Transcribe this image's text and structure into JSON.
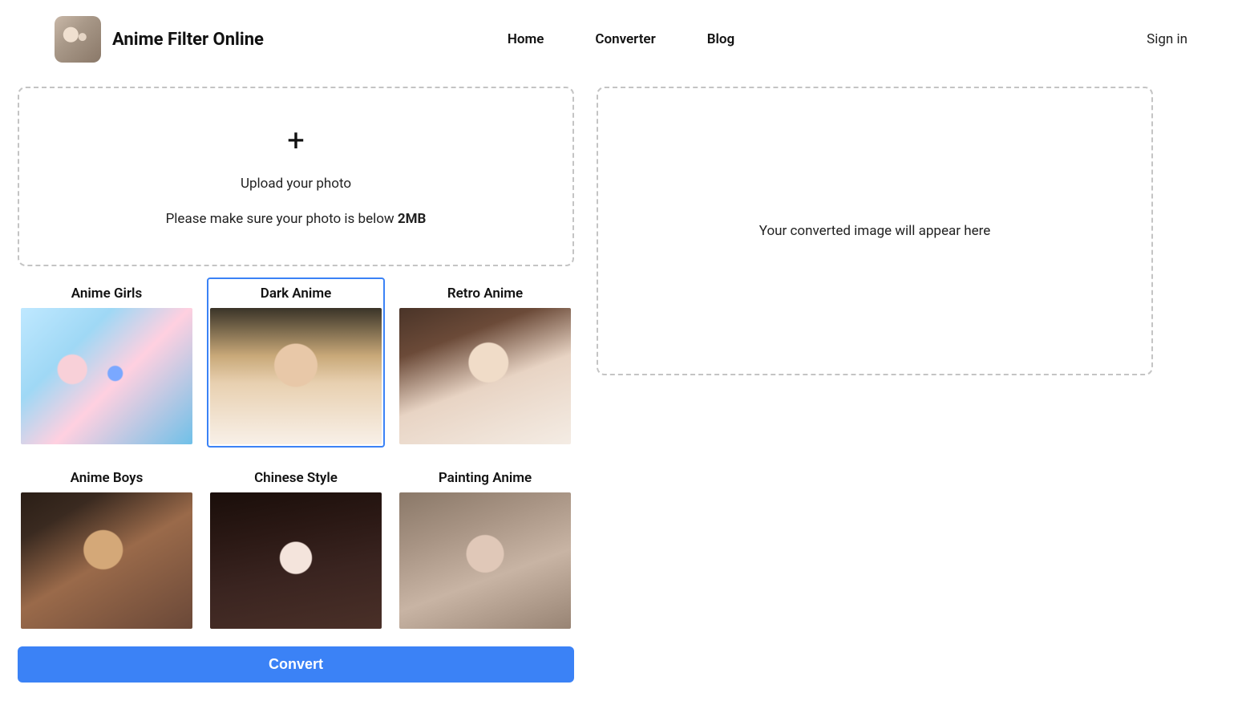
{
  "header": {
    "site_title": "Anime Filter Online",
    "nav": [
      {
        "label": "Home"
      },
      {
        "label": "Converter"
      },
      {
        "label": "Blog"
      }
    ],
    "signin": "Sign in"
  },
  "upload": {
    "prompt": "Upload your photo",
    "note_prefix": "Please make sure your photo is below ",
    "note_limit": "2MB",
    "plus_glyph": "+"
  },
  "styles": [
    {
      "label": "Anime Girls",
      "thumb_class": "th-anime-girls",
      "selected": false
    },
    {
      "label": "Dark Anime",
      "thumb_class": "th-dark-anime",
      "selected": true
    },
    {
      "label": "Retro Anime",
      "thumb_class": "th-retro-anime",
      "selected": false
    },
    {
      "label": "Anime Boys",
      "thumb_class": "th-anime-boys",
      "selected": false
    },
    {
      "label": "Chinese Style",
      "thumb_class": "th-chinese-style",
      "selected": false
    },
    {
      "label": "Painting Anime",
      "thumb_class": "th-painting-anime",
      "selected": false
    }
  ],
  "convert_label": "Convert",
  "output": {
    "placeholder": "Your converted image will appear here"
  }
}
